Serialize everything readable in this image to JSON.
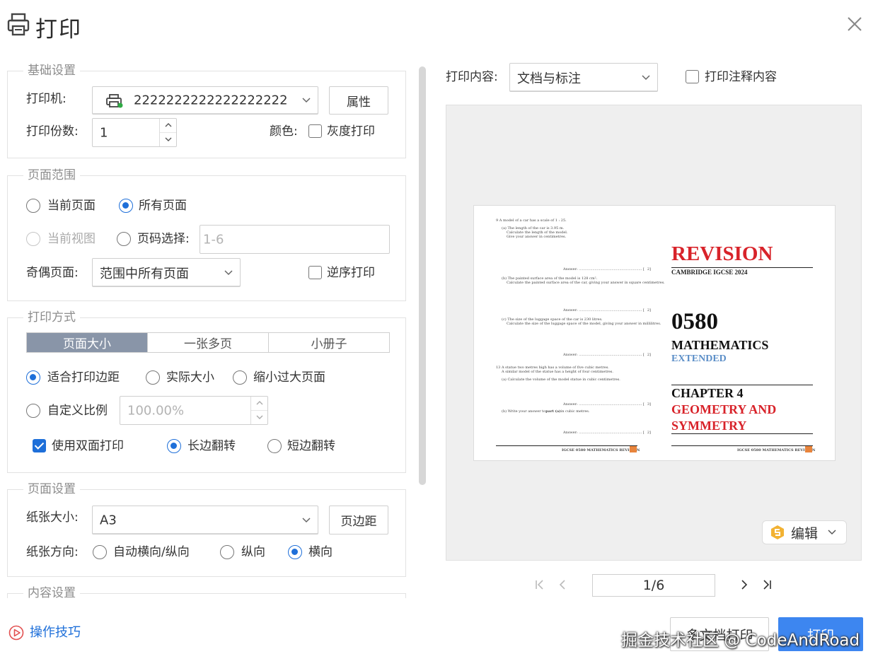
{
  "dialog": {
    "title": "打印",
    "tips_label": "操作技巧"
  },
  "basic": {
    "legend": "基础设置",
    "printer_label": "打印机:",
    "printer_value": "2222222222222222222",
    "properties_button": "属性",
    "copies_label": "打印份数:",
    "copies_value": "1",
    "color_label": "颜色:",
    "grayscale_label": "灰度打印",
    "grayscale_checked": false
  },
  "range": {
    "legend": "页面范围",
    "current_page": "当前页面",
    "all_pages": "所有页面",
    "current_view": "当前视图",
    "page_select": "页码选择:",
    "page_select_value": "1-6",
    "odd_even_label": "奇偶页面:",
    "odd_even_value": "范围中所有页面",
    "reverse_label": "逆序打印"
  },
  "mode": {
    "legend": "打印方式",
    "tabs": [
      "页面大小",
      "一张多页",
      "小册子"
    ],
    "active_tab": 0,
    "fit_margin": "适合打印边距",
    "actual_size": "实际大小",
    "shrink_oversized": "缩小过大页面",
    "custom_scale": "自定义比例",
    "custom_scale_value": "100.00%",
    "duplex_label": "使用双面打印",
    "duplex_checked": true,
    "long_edge": "长边翻转",
    "short_edge": "短边翻转"
  },
  "page_setup": {
    "legend": "页面设置",
    "paper_size_label": "纸张大小:",
    "paper_size_value": "A3",
    "margins_button": "页边距",
    "orientation_label": "纸张方向:",
    "auto_orientation": "自动横向/纵向",
    "portrait": "纵向",
    "landscape": "横向"
  },
  "content": {
    "legend": "内容设置"
  },
  "preview": {
    "content_label": "打印内容:",
    "content_value": "文档与标注",
    "annotations_label": "打印注释内容",
    "edit_button": "编辑",
    "page_indicator": "1/6",
    "left_page": {
      "q9_head": "9   A model of a car has a scale of 1 : 25.",
      "q9a_1": "(a)  The length of the car is 3.95 m.",
      "q9a_2": "Calculate the length of the model.",
      "q9a_3": "Give your answer in centimetres.",
      "q9b_1": "(b)  The painted surface area of the model is 128 cm².",
      "q9b_2": "Calculate the painted surface area of the car, giving your answer in square centimetres.",
      "q9c_1": "(c)  The size of the luggage space of the car is 230 litres.",
      "q9c_2": "Calculate the size of the luggage space of the model, giving your answer in millilitres.",
      "q13_1": "13  A statue two metres high has a volume of five cubic metres.",
      "q13_2": "A similar model of the statue has a height of four centimetres.",
      "q13a": "(a)  Calculate the volume of the model statue in cubic centimetres.",
      "q13b_pre": "(b)  Write your answer to ",
      "q13b_bold": "part (a)",
      "q13b_post": " in cubic metres.",
      "answer_label": "Answer: ........................................................ [",
      "marks": [
        "2]",
        "2]",
        "2]",
        "3]",
        "2]",
        "1]"
      ],
      "footer": "IGCSE 0580 MATHEMATICS REVISION"
    },
    "right_page": {
      "revision": "REVISION",
      "exam": "CAMBRIDGE IGCSE 2024",
      "code": "0580",
      "subject": "MATHEMATICS",
      "level": "EXTENDED",
      "chapter": "CHAPTER 4",
      "topic_1": "GEOMETRY AND",
      "topic_2": "SYMMETRY",
      "footer": "IGCSE 0580 MATHEMATICS REVISION"
    }
  },
  "footer": {
    "multi_doc_button": "多文档打印",
    "print_button": "打印",
    "watermark": "掘金技术社区 @ CodeAndRoad"
  },
  "colors": {
    "accent": "#1e6fd9",
    "print_button": "#3d86f0",
    "revision_red": "#d8232a",
    "extended_blue": "#5b8ec7",
    "footer_orange": "#e8843c"
  }
}
